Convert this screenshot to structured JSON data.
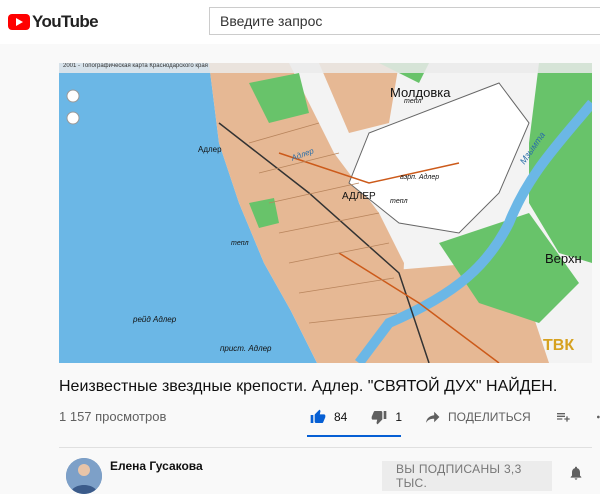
{
  "header": {
    "logo_text": "YouTube",
    "search_placeholder": "Введите запрос"
  },
  "video": {
    "map_header": "2001 - Топографическая карта Краснодарского края",
    "map_labels": {
      "moldovka": "Молдовка",
      "adler_caps": "АДЛЕР",
      "adler": "Адлер",
      "verkh": "Верхн",
      "reid": "рейд Адлер",
      "prist": "прист. Адлер",
      "mzymta": "Мзымта",
      "tepl1": "тепл",
      "tepl2": "тепл",
      "tepl3": "тепл",
      "airport": "аэрп. Адлер",
      "adler_line": "Адлер"
    },
    "watermark": "ТВК"
  },
  "title": "Неизвестные звездные крепости. Адлер. \"СВЯТОЙ ДУХ\" НАЙДЕН.",
  "views": "1 157 просмотров",
  "actions": {
    "likes": "84",
    "dislikes": "1",
    "share_label": "ПОДЕЛИТЬСЯ"
  },
  "channel": {
    "name": "Елена Гусакова",
    "subscribe_label": "ВЫ ПОДПИСАНЫ 3,3 ТЫС."
  },
  "colors": {
    "brand_red": "#ff0000",
    "like_blue": "#065fd4",
    "sea": "#6bb7e6",
    "land": "#f3f3f3",
    "town": "#e6b894",
    "forest": "#68c36a"
  }
}
